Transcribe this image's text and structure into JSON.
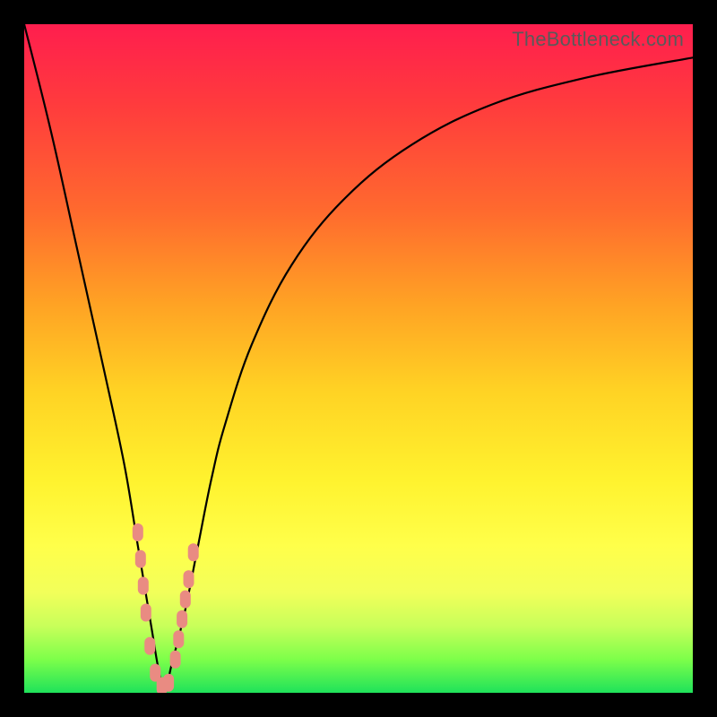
{
  "watermark": "TheBottleneck.com",
  "chart_data": {
    "type": "line",
    "title": "",
    "xlabel": "",
    "ylabel": "",
    "xlim": [
      0,
      100
    ],
    "ylim": [
      0,
      100
    ],
    "series": [
      {
        "name": "bottleneck-curve",
        "x": [
          0,
          4,
          8,
          12,
          15,
          17,
          19,
          20,
          21,
          22,
          24,
          26,
          28,
          30,
          34,
          40,
          48,
          58,
          70,
          84,
          100
        ],
        "y": [
          100,
          84,
          66,
          48,
          34,
          22,
          10,
          4,
          0,
          4,
          12,
          22,
          32,
          40,
          52,
          64,
          74,
          82,
          88,
          92,
          95
        ]
      }
    ],
    "markers": {
      "name": "highlight-points",
      "color": "#e98b82",
      "points": [
        {
          "x": 17.0,
          "y": 24.0
        },
        {
          "x": 17.4,
          "y": 20.0
        },
        {
          "x": 17.8,
          "y": 16.0
        },
        {
          "x": 18.2,
          "y": 12.0
        },
        {
          "x": 18.8,
          "y": 7.0
        },
        {
          "x": 19.6,
          "y": 3.0
        },
        {
          "x": 20.6,
          "y": 1.0
        },
        {
          "x": 21.6,
          "y": 1.5
        },
        {
          "x": 22.6,
          "y": 5.0
        },
        {
          "x": 23.1,
          "y": 8.0
        },
        {
          "x": 23.6,
          "y": 11.0
        },
        {
          "x": 24.1,
          "y": 14.0
        },
        {
          "x": 24.6,
          "y": 17.0
        },
        {
          "x": 25.3,
          "y": 21.0
        }
      ]
    },
    "background_gradient": {
      "top": "#ff1e4e",
      "upper_mid": "#ffa324",
      "mid": "#fff22e",
      "lower_mid": "#c8ff5a",
      "bottom": "#1fe25a"
    }
  }
}
